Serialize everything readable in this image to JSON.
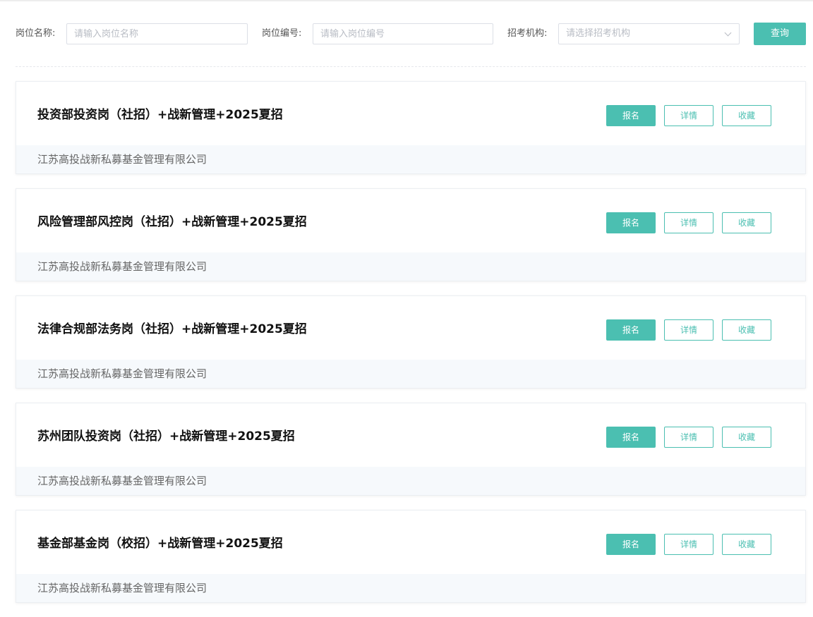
{
  "search": {
    "position_name_label": "岗位名称:",
    "position_name_placeholder": "请输入岗位名称",
    "position_code_label": "岗位编号:",
    "position_code_placeholder": "请输入岗位编号",
    "org_label": "招考机构:",
    "org_placeholder": "请选择招考机构",
    "query_label": "查询"
  },
  "buttons": {
    "apply": "报名",
    "detail": "详情",
    "favorite": "收藏"
  },
  "jobs": [
    {
      "title": "投资部投资岗（社招）+战新管理+2025夏招",
      "company": "江苏高投战新私募基金管理有限公司"
    },
    {
      "title": "风险管理部风控岗（社招）+战新管理+2025夏招",
      "company": "江苏高投战新私募基金管理有限公司"
    },
    {
      "title": "法律合规部法务岗（社招）+战新管理+2025夏招",
      "company": "江苏高投战新私募基金管理有限公司"
    },
    {
      "title": "苏州团队投资岗（社招）+战新管理+2025夏招",
      "company": "江苏高投战新私募基金管理有限公司"
    },
    {
      "title": "基金部基金岗（校招）+战新管理+2025夏招",
      "company": "江苏高投战新私募基金管理有限公司"
    }
  ],
  "colors": {
    "accent": "#4bbfb1",
    "footer_bg": "#f6f9fc"
  }
}
